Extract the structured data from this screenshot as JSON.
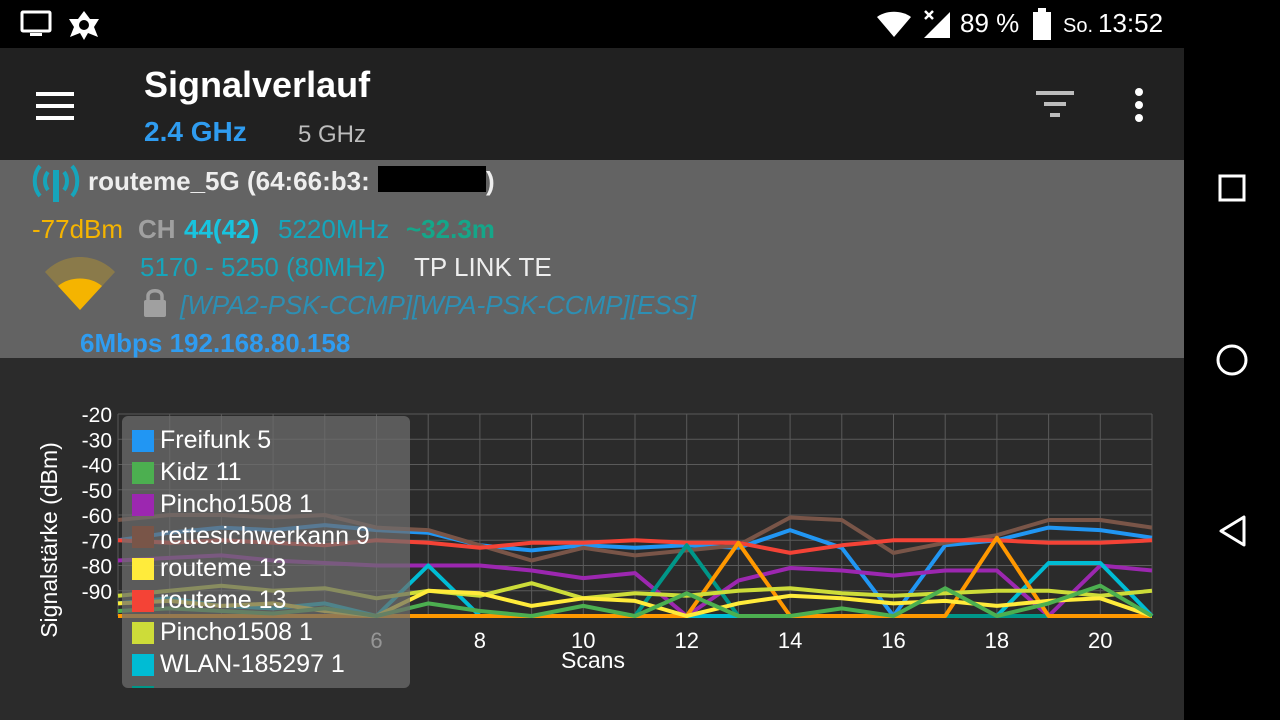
{
  "status_bar": {
    "left_icons": [
      "screen-cast-icon",
      "app-logo-icon"
    ],
    "battery": "89 %",
    "day": "So.",
    "time": "13:52",
    "right_icons": [
      "wifi-icon",
      "cell-signal-icon",
      "battery-icon"
    ]
  },
  "app_bar": {
    "title": "Signalverlauf",
    "tabs": [
      {
        "label": "2.4 GHz",
        "selected": true
      },
      {
        "label": "5 GHz",
        "selected": false
      }
    ],
    "icons": [
      "menu-icon",
      "filter-icon",
      "more-vert-icon"
    ]
  },
  "network": {
    "ssid_label": "routeme_5G (64:66:b3:",
    "bssid_suffix": ")",
    "level": "-77dBm",
    "ch_label": "CH",
    "channel": "44(42)",
    "frequency": "5220MHz",
    "distance": "~32.3m",
    "range": "5170 - 5250 (80MHz)",
    "vendor": "TP LINK TE",
    "capabilities": "[WPA2-PSK-CCMP][WPA-PSK-CCMP][ESS]",
    "link": "6Mbps 192.168.80.158",
    "colors": {
      "level": "#f5b400",
      "channel": "#18c4df",
      "frequency": "#16a5bb",
      "distance": "#15a689",
      "range": "#16a5bb",
      "capabilities": "#2d8fb3",
      "link": "#2f9cf0"
    }
  },
  "nav_bar": {
    "icons": [
      "recents-icon",
      "home-icon",
      "back-icon"
    ]
  },
  "chart_data": {
    "type": "line",
    "xlabel": "Scans",
    "ylabel": "Signalstärke (dBm)",
    "ylim": [
      -100,
      -20
    ],
    "xlim": [
      1,
      21
    ],
    "x_ticks": [
      "6",
      "8",
      "10",
      "12",
      "14",
      "16",
      "18",
      "20"
    ],
    "y_ticks": [
      "-20",
      "-30",
      "-40",
      "-50",
      "-60",
      "-70",
      "-80",
      "-90"
    ],
    "grid": true,
    "legend_position": "top-left",
    "legend": [
      {
        "label": "Freifunk 5",
        "color": "#2196f3"
      },
      {
        "label": "Kidz 11",
        "color": "#4caf50"
      },
      {
        "label": "Pincho1508 1",
        "color": "#9c27b0"
      },
      {
        "label": "rettesichwerkann 9",
        "color": "#795548"
      },
      {
        "label": "routeme 13",
        "color": "#ffeb3b"
      },
      {
        "label": "routeme 13",
        "color": "#f44336"
      },
      {
        "label": "Pincho1508 1",
        "color": "#cddc39"
      },
      {
        "label": "WLAN-185297 1",
        "color": "#00bcd4"
      },
      {
        "label": "",
        "color": "#009688"
      }
    ],
    "series": [
      {
        "name": "Freifunk 5",
        "color": "#2196f3",
        "x": [
          1,
          2,
          3,
          4,
          5,
          6,
          7,
          8,
          9,
          10,
          11,
          12,
          13,
          14,
          15,
          16,
          17,
          18,
          19,
          20,
          21
        ],
        "values": [
          -70,
          -67,
          -65,
          -66,
          -64,
          -66,
          -67,
          -72,
          -74,
          -72,
          -73,
          -72,
          -73,
          -66,
          -73,
          -100,
          -72,
          -70,
          -65,
          -66,
          -69
        ]
      },
      {
        "name": "rettesichwerkann 9",
        "color": "#795548",
        "x": [
          1,
          2,
          3,
          4,
          5,
          6,
          7,
          8,
          9,
          10,
          11,
          12,
          13,
          14,
          15,
          16,
          17,
          18,
          19,
          20,
          21
        ],
        "values": [
          -62,
          -60,
          -60,
          -61,
          -60,
          -65,
          -66,
          -72,
          -78,
          -73,
          -76,
          -74,
          -72,
          -61,
          -62,
          -75,
          -71,
          -68,
          -62,
          -62,
          -65
        ]
      },
      {
        "name": "routeme 13",
        "color": "#f44336",
        "x": [
          1,
          2,
          3,
          4,
          5,
          6,
          7,
          8,
          9,
          10,
          11,
          12,
          13,
          14,
          15,
          16,
          17,
          18,
          19,
          20,
          21
        ],
        "values": [
          -70,
          -71,
          -70,
          -71,
          -72,
          -70,
          -71,
          -73,
          -71,
          -71,
          -70,
          -71,
          -71,
          -75,
          -72,
          -70,
          -70,
          -70,
          -71,
          -71,
          -70
        ]
      },
      {
        "name": "Pincho1508 1",
        "color": "#9c27b0",
        "x": [
          1,
          2,
          3,
          4,
          5,
          6,
          7,
          8,
          9,
          10,
          11,
          12,
          13,
          14,
          15,
          16,
          17,
          18,
          19,
          20,
          21
        ],
        "values": [
          -78,
          -77,
          -76,
          -78,
          -79,
          -80,
          -80,
          -80,
          -82,
          -85,
          -83,
          -100,
          -86,
          -81,
          -82,
          -84,
          -82,
          -82,
          -100,
          -80,
          -82
        ]
      },
      {
        "name": "WLAN-185297 1",
        "color": "#00bcd4",
        "x": [
          1,
          2,
          3,
          4,
          5,
          6,
          7,
          8,
          9,
          10,
          11,
          12,
          13,
          14,
          15,
          16,
          17,
          18,
          19,
          20,
          21
        ],
        "values": [
          -95,
          -93,
          -96,
          -97,
          -95,
          -100,
          -80,
          -100,
          -100,
          -100,
          -100,
          -100,
          -100,
          -100,
          -100,
          -100,
          -100,
          -100,
          -79,
          -79,
          -100
        ]
      },
      {
        "name": "",
        "color": "#009688",
        "x": [
          1,
          2,
          3,
          4,
          5,
          6,
          7,
          8,
          9,
          10,
          11,
          12,
          13,
          14,
          15,
          16,
          17,
          18,
          19,
          20,
          21
        ],
        "values": [
          -100,
          -100,
          -100,
          -100,
          -100,
          -100,
          -100,
          -100,
          -100,
          -100,
          -100,
          -72,
          -100,
          -100,
          -100,
          -100,
          -100,
          -100,
          -100,
          -100,
          -100
        ]
      },
      {
        "name": "routeme 13",
        "color": "#ff9800",
        "x": [
          1,
          2,
          3,
          4,
          5,
          6,
          7,
          8,
          9,
          10,
          11,
          12,
          13,
          14,
          15,
          16,
          17,
          18,
          19,
          20,
          21
        ],
        "values": [
          -100,
          -100,
          -100,
          -100,
          -100,
          -100,
          -100,
          -100,
          -100,
          -100,
          -100,
          -100,
          -71,
          -100,
          -100,
          -100,
          -100,
          -69,
          -100,
          -100,
          -100
        ]
      },
      {
        "name": "Pincho1508 1",
        "color": "#cddc39",
        "x": [
          1,
          2,
          3,
          4,
          5,
          6,
          7,
          8,
          9,
          10,
          11,
          12,
          13,
          14,
          15,
          16,
          17,
          18,
          19,
          20,
          21
        ],
        "values": [
          -92,
          -90,
          -88,
          -90,
          -89,
          -93,
          -90,
          -92,
          -87,
          -93,
          -91,
          -92,
          -90,
          -89,
          -91,
          -92,
          -91,
          -90,
          -90,
          -92,
          -90
        ]
      },
      {
        "name": "routeme 13",
        "color": "#ffeb3b",
        "x": [
          1,
          2,
          3,
          4,
          5,
          6,
          7,
          8,
          9,
          10,
          11,
          12,
          13,
          14,
          15,
          16,
          17,
          18,
          19,
          20,
          21
        ],
        "values": [
          -95,
          -94,
          -96,
          -95,
          -98,
          -100,
          -90,
          -91,
          -96,
          -93,
          -94,
          -100,
          -95,
          -92,
          -93,
          -95,
          -94,
          -96,
          -94,
          -93,
          -100
        ]
      },
      {
        "name": "Kidz 11",
        "color": "#4caf50",
        "x": [
          1,
          2,
          3,
          4,
          5,
          6,
          7,
          8,
          9,
          10,
          11,
          12,
          13,
          14,
          15,
          16,
          17,
          18,
          19,
          20,
          21
        ],
        "values": [
          -98,
          -97,
          -98,
          -99,
          -97,
          -100,
          -95,
          -98,
          -100,
          -96,
          -100,
          -91,
          -100,
          -100,
          -97,
          -100,
          -89,
          -100,
          -95,
          -88,
          -100
        ]
      }
    ]
  }
}
